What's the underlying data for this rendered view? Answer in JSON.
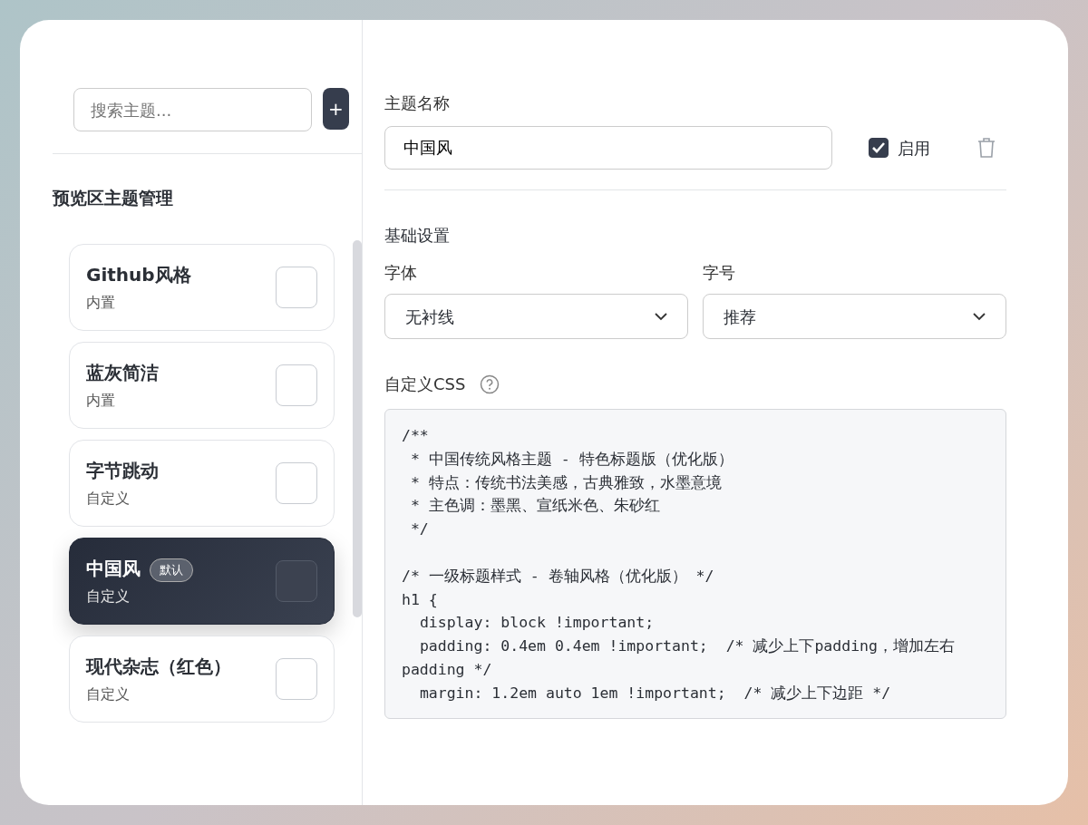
{
  "search": {
    "placeholder": "搜索主题..."
  },
  "add_button": {
    "label": "+"
  },
  "sidebar": {
    "title": "预览区主题管理",
    "items": [
      {
        "title": "Github风格",
        "subtitle": "内置",
        "selected": false,
        "checked": false
      },
      {
        "title": "蓝灰简洁",
        "subtitle": "内置",
        "selected": false,
        "checked": false
      },
      {
        "title": "字节跳动",
        "subtitle": "自定义",
        "selected": false,
        "checked": false
      },
      {
        "title": "中国风",
        "badge": "默认",
        "subtitle": "自定义",
        "selected": true,
        "checked": false
      },
      {
        "title": "现代杂志（红色）",
        "subtitle": "自定义",
        "selected": false,
        "checked": false
      }
    ]
  },
  "editor": {
    "name_label": "主题名称",
    "name_value": "中国风",
    "enabled": {
      "label": "启用",
      "checked": true
    },
    "section_title": "基础设置",
    "font": {
      "label": "字体",
      "value": "无衬线"
    },
    "size": {
      "label": "字号",
      "value": "推荐"
    },
    "css_label": "自定义CSS",
    "css_blocks": [
      [
        "/**",
        " * 中国传统风格主题 - 特色标题版（优化版）",
        " * 特点：传统书法美感，古典雅致，水墨意境",
        " * 主色调：墨黑、宣纸米色、朱砂红",
        " */"
      ],
      [
        "/* 一级标题样式 - 卷轴风格（优化版） */",
        "h1 {",
        "  display: block !important;",
        "  padding: 0.4em 0.4em !important;  /* 减少上下padding，增加左右padding */",
        "  margin: 1.2em auto 1em !important;  /* 减少上下边距 */"
      ]
    ]
  }
}
